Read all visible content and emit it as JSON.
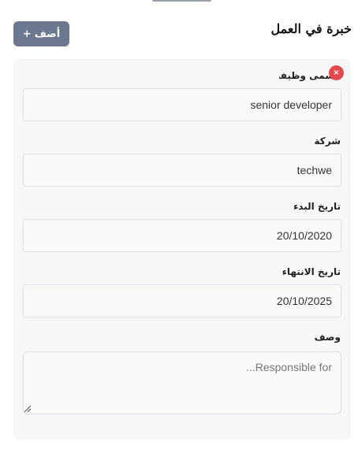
{
  "header": {
    "title": "خبرة في العمل",
    "add_button_label": "أضف",
    "add_button_icon": "+"
  },
  "entry": {
    "remove_icon": "×",
    "fields": {
      "job_title": {
        "label": "مسمى وظيفي",
        "value": "senior developer"
      },
      "company": {
        "label": "شركة",
        "value": "techwe"
      },
      "start_date": {
        "label": "تاريخ البدء",
        "value": "20/10/2020"
      },
      "end_date": {
        "label": "تاريخ الانتهاء",
        "value": "20/10/2025"
      },
      "description": {
        "label": "وصف",
        "value": "",
        "placeholder": "...Responsible for"
      }
    }
  },
  "colors": {
    "add_button": "#6b7890",
    "card_background": "#f6f7f9",
    "remove_button": "#e5484d"
  }
}
